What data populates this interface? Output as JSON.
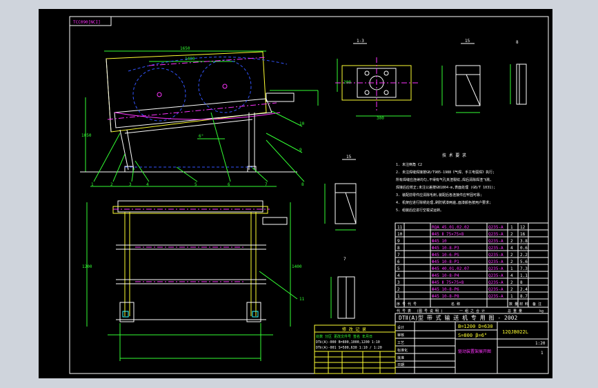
{
  "drawing": {
    "stamp": "TCC090[NCI]",
    "views": {
      "section_1_3": "1-3",
      "section_1_5": "15",
      "section_1_5b": "15",
      "view_10": "10",
      "view_8": "8",
      "view_7": "7"
    },
    "tech_title": "技 术 要 求",
    "tech_notes": [
      "1. 未注倒角 C2",
      "2. 未注焊缝焊接按GB/T985-1988《气焊、手工电弧焊》执行;",
      "   所有焊缝应连续均匀,不得有气孔夹渣裂纹,焊后清除焊渣飞溅,",
      "   焊接后应校正;未注公差按GB1804-m,表面处理 (GB/T 1031);",
      "3. 装配前零件应清除毛刺,装配后各连接件应牢固可靠;",
      "4. 机架应进行除锈处理,刷防锈漆两遍,面漆颜色按用户要求;",
      "5. 组装后应进行空载试运转。"
    ],
    "part_numbers": [
      "1",
      "2",
      "3",
      "4",
      "5",
      "6",
      "7",
      "8",
      "9",
      "10",
      "11"
    ],
    "parts_table": {
      "rows": [
        {
          "no": "11",
          "name": "RQA 45.01.02.02",
          "material": "Q235-A",
          "qty": "1",
          "mass": "12"
        },
        {
          "no": "10",
          "name": "Φ45 Ⅱ 75×75×8",
          "material": "Q235-A",
          "qty": "2",
          "mass": "16"
        },
        {
          "no": "9",
          "name": "Φ45 10",
          "material": "Q235-A",
          "qty": "2",
          "mass": "3.8"
        },
        {
          "no": "8",
          "name": "Φ45 10-8-P3",
          "material": "Q235-A",
          "qty": "4",
          "mass": "0.6"
        },
        {
          "no": "7",
          "name": "Φ45 10-6-PS",
          "material": "Q235-A",
          "qty": "2",
          "mass": "2.2"
        },
        {
          "no": "6",
          "name": "Φ45 10-8-P1",
          "material": "Q235-A",
          "qty": "2",
          "mass": "5.6"
        },
        {
          "no": "5",
          "name": "Φ45 40.01.02.07",
          "material": "Q235-A",
          "qty": "1",
          "mass": "7.3"
        },
        {
          "no": "4",
          "name": "Φ45 10-8-P4",
          "material": "Q235-A",
          "qty": "4",
          "mass": "1.1"
        },
        {
          "no": "3",
          "name": "Φ45 Ⅱ 75×75×8",
          "material": "Q235-A",
          "qty": "2",
          "mass": "8"
        },
        {
          "no": "2",
          "name": "Φ45 10-8-P6",
          "material": "Q235-A",
          "qty": "2",
          "mass": "2.4"
        },
        {
          "no": "1",
          "name": "Φ45 10-8-P8",
          "material": "Q235-A",
          "qty": "1",
          "mass": "8.7"
        }
      ],
      "header": [
        "序 号",
        "代 号",
        "名 称",
        "数 量",
        "材 料",
        "备 注"
      ],
      "units_row": [
        "代 号 表",
        "(图 号 说 明 )",
        "一 组 之 合 计",
        "总 重 量",
        "kg"
      ]
    },
    "title_block": {
      "main_title": "DTⅡ(A)型 带 式 输 送 机 专 用 图 - 2002",
      "param_1": "B=1200  D=630",
      "param_2": "S=800  β=6°",
      "drawing_code": "12QJB022L",
      "part_name": "驱动装置架展开图",
      "small_fields": [
        "设计",
        "审核",
        "工艺",
        "标准化",
        "批准",
        "日期"
      ],
      "scale": "1:20",
      "sheet": "1"
    },
    "revision_table": {
      "title": "修 改 记 录",
      "rows": [
        "处数 分区 更改文件号 签名 年月日",
        "DTⅡ(A)-000 B=800,1000,1200 1:10",
        "DTⅡ(A)-001 S=500,630 1:10 / 1:20"
      ]
    },
    "dimensions": {
      "top_span": "1650",
      "inner_span": "1400",
      "height_left": "1050",
      "height_plan": "1200",
      "height_plan2": "1400",
      "plate_w": "300",
      "plate_h": "200",
      "angle": "6°"
    }
  }
}
